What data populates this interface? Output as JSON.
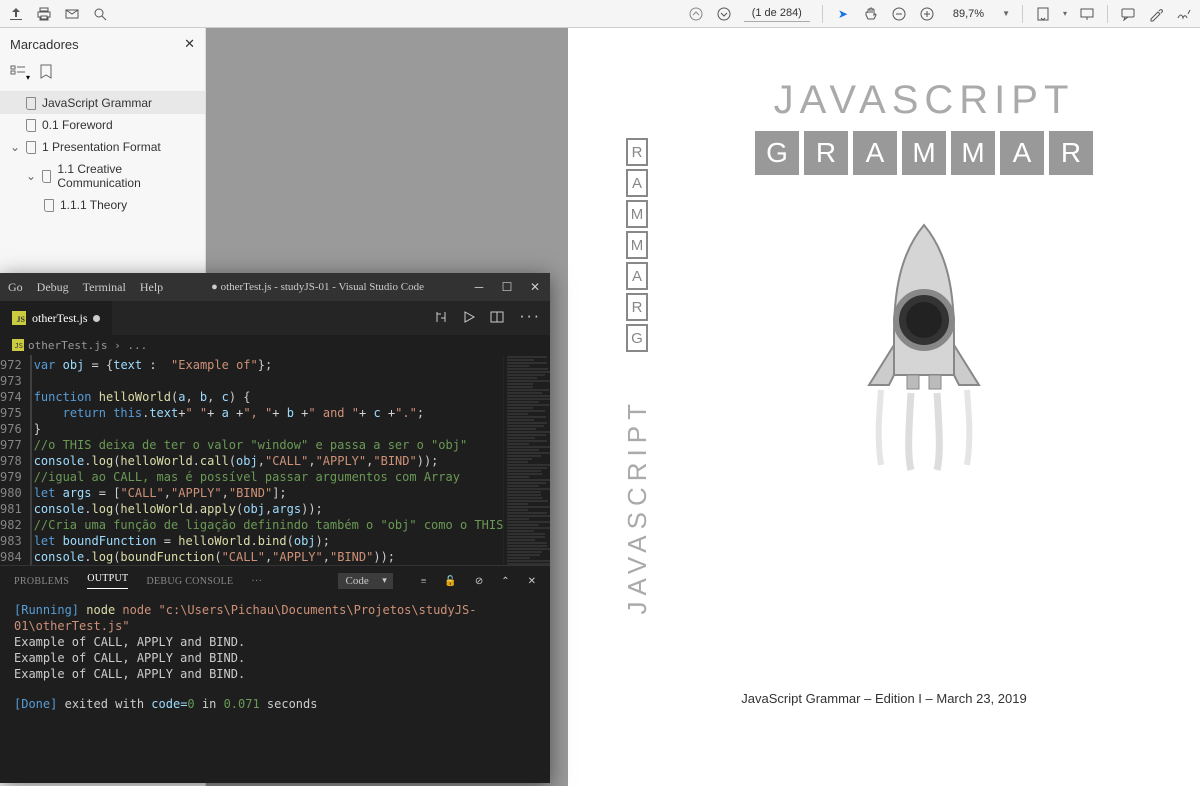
{
  "pdf_toolbar": {
    "page_info": "(1 de 284)",
    "zoom": "89,7%"
  },
  "bookmarks": {
    "title": "Marcadores",
    "items": [
      {
        "label": "JavaScript Grammar",
        "active": true
      },
      {
        "label": "0.1 Foreword"
      },
      {
        "label": "1 Presentation Format",
        "expanded": true
      },
      {
        "label": "1.1 Creative Communication",
        "expanded": true
      },
      {
        "label": "1.1.1 Theory"
      }
    ]
  },
  "vscode": {
    "menu": [
      "Go",
      "Debug",
      "Terminal",
      "Help"
    ],
    "title": "● otherTest.js - studyJS-01 - Visual Studio Code",
    "tab": "otherTest.js",
    "breadcrumb": "otherTest.js › ...",
    "line_start": 972,
    "code_lines": [
      "<span class='kw'>var</span> <span class='var2'>obj</span> <span class='op'>=</span> {<span class='var2'>text</span> <span class='op'>:</span>  <span class='str'>\"Example of\"</span>};",
      "",
      "<span class='kw'>function</span> <span class='fn'>helloWorld</span>(<span class='var2'>a</span>, <span class='var2'>b</span>, <span class='var2'>c</span>) {",
      "    <span class='kw'>return</span> <span class='this'>this</span>.<span class='var2'>text</span><span class='op'>+</span><span class='str'>\" \"</span><span class='op'>+</span> <span class='var2'>a</span> <span class='op'>+</span><span class='str'>\", \"</span><span class='op'>+</span> <span class='var2'>b</span> <span class='op'>+</span><span class='str'>\" and \"</span><span class='op'>+</span> <span class='var2'>c</span> <span class='op'>+</span><span class='str'>\".\"</span>;",
      "}",
      "<span class='cmt'>//o THIS deixa de ter o valor \"window\" e passa a ser o \"obj\"</span>",
      "<span class='var2'>console</span>.<span class='fn'>log</span>(<span class='fn'>helloWorld</span>.<span class='fn'>call</span>(<span class='var2'>obj</span>,<span class='str'>\"CALL\"</span>,<span class='str'>\"APPLY\"</span>,<span class='str'>\"BIND\"</span>));",
      "<span class='cmt'>//igual ao CALL, mas é possível passar argumentos com Array</span>",
      "<span class='kw'>let</span> <span class='var2'>args</span> <span class='op'>=</span> [<span class='str'>\"CALL\"</span>,<span class='str'>\"APPLY\"</span>,<span class='str'>\"BIND\"</span>];",
      "<span class='var2'>console</span>.<span class='fn'>log</span>(<span class='fn'>helloWorld</span>.<span class='fn'>apply</span>(<span class='var2'>obj</span>,<span class='var2'>args</span>));",
      "<span class='cmt'>//Cria uma função de ligação definindo também o \"obj\" como o THIS</span>",
      "<span class='kw'>let</span> <span class='var2'>boundFunction</span> <span class='op'>=</span> <span class='fn'>helloWorld</span>.<span class='fn'>bind</span>(<span class='var2'>obj</span>);",
      "<span class='var2'>console</span>.<span class='fn'>log</span>(<span class='fn'>boundFunction</span>(<span class='str'>\"CALL\"</span>,<span class='str'>\"APPLY\"</span>,<span class='str'>\"BIND\"</span>));",
      ""
    ],
    "panel_tabs": [
      "PROBLEMS",
      "OUTPUT",
      "DEBUG CONSOLE",
      "···"
    ],
    "panel_select": "Code",
    "output": {
      "running_label": "[Running]",
      "running_cmd": "node \"c:\\Users\\Pichau\\Documents\\Projetos\\studyJS-01\\otherTest.js\"",
      "lines": [
        "Example of CALL, APPLY and BIND.",
        "Example of CALL, APPLY and BIND.",
        "Example of CALL, APPLY and BIND."
      ],
      "done_label": "[Done]",
      "done_text": "exited with ",
      "code_label": "code=",
      "code_val": "0",
      "in_label": " in ",
      "time": "0.071",
      "seconds": " seconds"
    }
  },
  "book": {
    "title": "JAVASCRIPT",
    "grammar": "GRAMMAR",
    "vert_title": "JAVASCRIPT",
    "footer": "JavaScript Grammar – Edition I – March 23, 2019"
  }
}
